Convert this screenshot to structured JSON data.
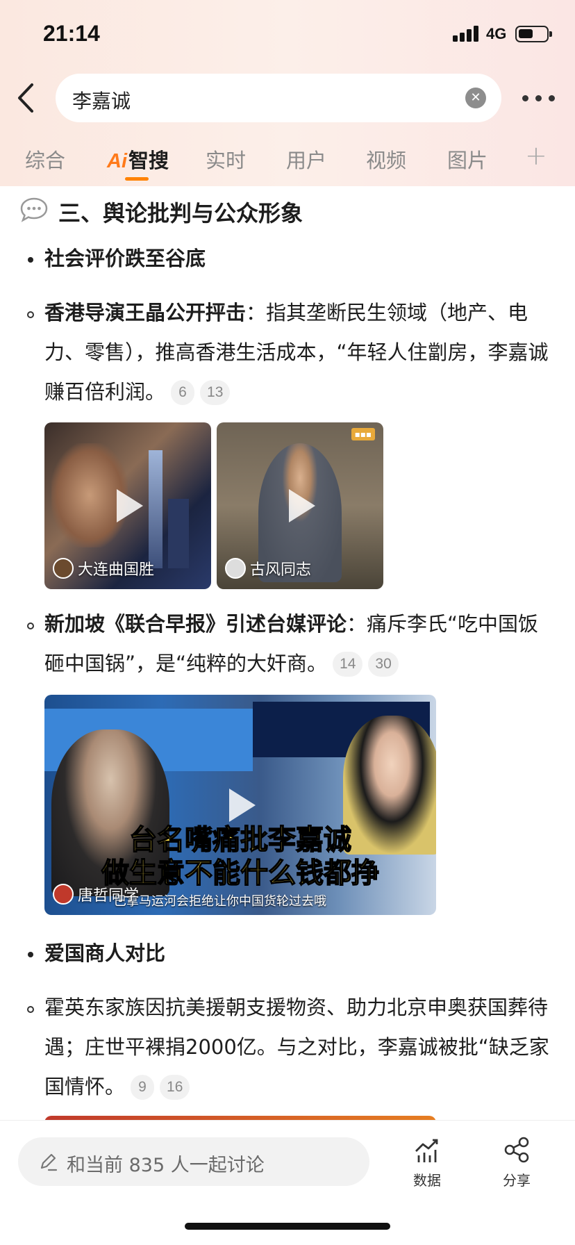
{
  "status_bar": {
    "time": "21:14",
    "network": "4G"
  },
  "search": {
    "query": "李嘉诚"
  },
  "tabs": [
    {
      "label": "综合"
    },
    {
      "label_ai": "Ai",
      "label": "智搜"
    },
    {
      "label": "实时"
    },
    {
      "label": "用户"
    },
    {
      "label": "视频"
    },
    {
      "label": "图片"
    }
  ],
  "section": {
    "title": "三、舆论批判与公众形象",
    "points": [
      {
        "heading": "社会评价跌至谷底",
        "items": [
          {
            "bold": "香港导演王晶公开抨击",
            "text": "：指其垄断民生领域（地产、电力、零售），推高香港生活成本，“年轻人住劏房，李嘉诚赚百倍利润。",
            "citations": [
              "6",
              "13"
            ],
            "videos": [
              {
                "author": "大连曲国胜"
              },
              {
                "author": "古风同志"
              }
            ]
          },
          {
            "bold": "新加坡《联合早报》引述台媒评论",
            "text": "：痛斥李氏“吃中国饭砸中国锅”，是“纯粹的大奸商。",
            "citations": [
              "14",
              "30"
            ],
            "videos": [
              {
                "author": "唐哲同学",
                "caption_line1": "台名嘴痛批李嘉诚",
                "caption_line2": "做生意不能什么钱都挣",
                "subtitle": "巴拿马运河会拒绝让你中国货轮过去哦"
              }
            ]
          }
        ]
      },
      {
        "heading": "爱国商人对比",
        "items": [
          {
            "text": "霍英东家族因抗美援朝支援物资、助力北京申奥获国葬待遇；庄世平裸捐2000亿。与之对比，李嘉诚被批“缺乏家国情怀。",
            "citations": [
              "9",
              "16"
            ]
          }
        ]
      }
    ]
  },
  "bottom_bar": {
    "discuss_placeholder": "和当前 835 人一起讨论",
    "data_label": "数据",
    "share_label": "分享"
  },
  "colors": {
    "accent": "#ff8200",
    "ai_orange": "#ff7a1a",
    "header_bg": "#fbe8e0"
  }
}
